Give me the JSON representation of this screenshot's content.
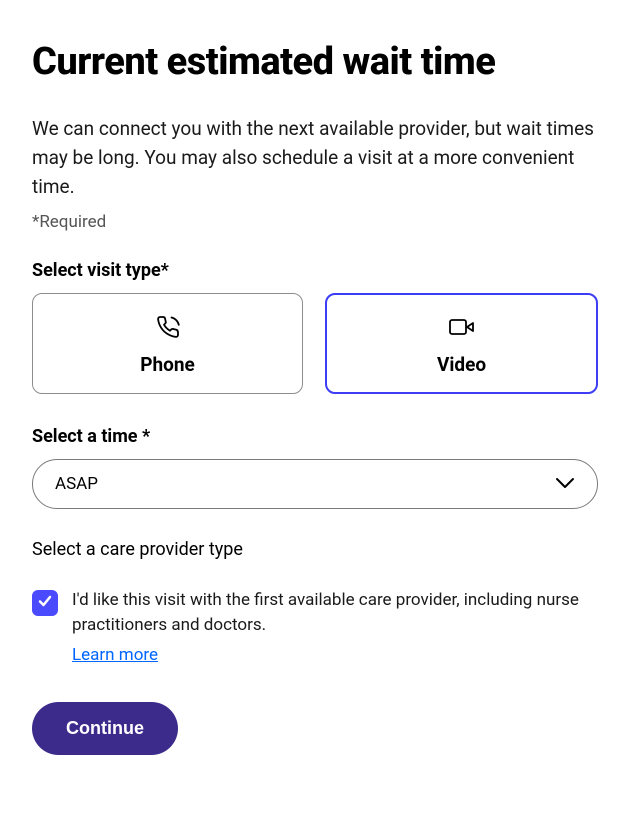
{
  "page": {
    "title": "Current estimated wait time",
    "intro": "We can connect you with the next available provider, but wait times may be long. You may also schedule a visit at a more convenient time.",
    "required_note": "*Required"
  },
  "visit_type": {
    "label": "Select visit type*",
    "options": [
      {
        "label": "Phone",
        "selected": false
      },
      {
        "label": "Video",
        "selected": true
      }
    ]
  },
  "time_select": {
    "label": "Select a time *",
    "value": "ASAP"
  },
  "provider": {
    "label": "Select a care provider type",
    "checkbox_text": "I'd like this visit with the first available care provider, including nurse practitioners and doctors.",
    "learn_more": "Learn more",
    "checked": true
  },
  "actions": {
    "continue": "Continue"
  }
}
